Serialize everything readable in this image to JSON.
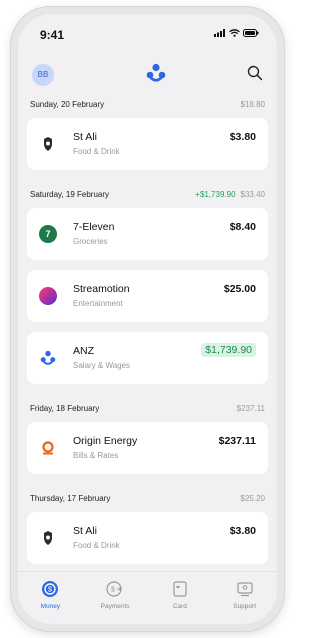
{
  "status": {
    "time": "9:41"
  },
  "header": {
    "avatar_initials": "BB"
  },
  "days": [
    {
      "date": "Sunday, 20 February",
      "credit": "",
      "total": "$18.80",
      "transactions": [
        {
          "merchant": "St Ali",
          "category": "Food & Drink",
          "amount": "$3.80",
          "icon": "st-ali-logo"
        }
      ]
    },
    {
      "date": "Saturday, 19 February",
      "credit": "+$1,739.90",
      "total": "$33.40",
      "transactions": [
        {
          "merchant": "7-Eleven",
          "category": "Groceries",
          "amount": "$8.40",
          "icon": "7-eleven-logo"
        },
        {
          "merchant": "Streamotion",
          "category": "Entertainment",
          "amount": "$25.00",
          "icon": "streamotion-logo"
        },
        {
          "merchant": "ANZ",
          "category": "Salary & Wages",
          "amount": "$1,739.90",
          "icon": "anz-logo"
        }
      ]
    },
    {
      "date": "Friday, 18 February",
      "credit": "",
      "total": "$237.11",
      "transactions": [
        {
          "merchant": "Origin Energy",
          "category": "Bills & Rates",
          "amount": "$237.11",
          "icon": "origin-energy-logo"
        }
      ]
    },
    {
      "date": "Thursday, 17 February",
      "credit": "",
      "total": "$25.20",
      "transactions": [
        {
          "merchant": "St Ali",
          "category": "Food & Drink",
          "amount": "$3.80",
          "icon": "st-ali-logo"
        }
      ]
    }
  ],
  "tabs": [
    {
      "label": "Money",
      "icon": "money-icon",
      "active": true
    },
    {
      "label": "Payments",
      "icon": "payments-icon",
      "active": false
    },
    {
      "label": "Card",
      "icon": "card-icon",
      "active": false
    },
    {
      "label": "Support",
      "icon": "support-icon",
      "active": false
    }
  ],
  "colors": {
    "accent": "#2f66e6",
    "credit": "#22a05a",
    "credit_bg": "#d8f3e3"
  }
}
